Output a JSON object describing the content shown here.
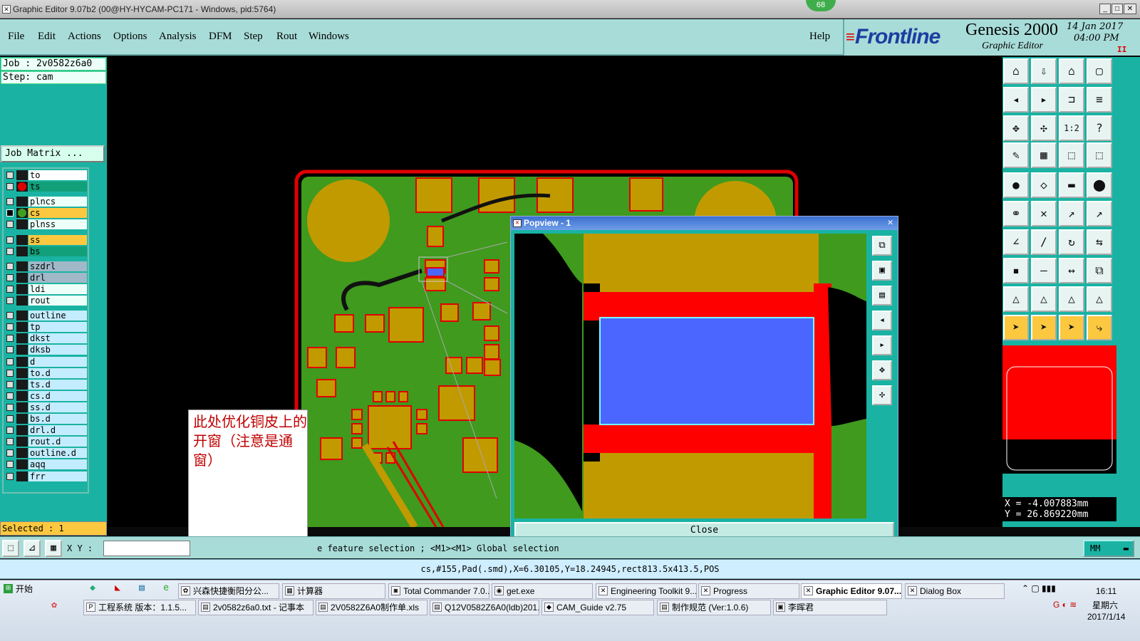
{
  "window": {
    "title": "Graphic Editor 9.07b2 (00@HY-HYCAM-PC171 - Windows, pid:5764)",
    "badge": "68"
  },
  "menu": {
    "items": [
      "File",
      "Edit",
      "Actions",
      "Options",
      "Analysis",
      "DFM",
      "Step",
      "Rout",
      "Windows"
    ],
    "help": "Help"
  },
  "brand": {
    "logo": "Frontline",
    "product": "Genesis 2000",
    "sub": "Graphic Editor",
    "date": "14 Jan 2017",
    "time": "04:00 PM",
    "indicator": "II"
  },
  "job": {
    "job_label": "Job : 2v0582z6a0",
    "step_label": "Step: cam",
    "matrix_btn": "Job Matrix ...",
    "selected": "Selected : 1"
  },
  "layers": [
    {
      "name": "to",
      "color": "#ffffff",
      "checked": false,
      "dot": ""
    },
    {
      "name": "ts",
      "color": "#12a07a",
      "checked": false,
      "dot": "#e00000"
    },
    {
      "name": "plncs",
      "color": "#ecfff9",
      "checked": false,
      "dot": ""
    },
    {
      "name": "cs",
      "color": "#fcc840",
      "checked": true,
      "dot": "#3fa020"
    },
    {
      "name": "plnss",
      "color": "#ecfff9",
      "checked": false,
      "dot": ""
    },
    {
      "name": "ss",
      "color": "#fcc840",
      "checked": false,
      "dot": ""
    },
    {
      "name": "bs",
      "color": "#12a07a",
      "checked": false,
      "dot": ""
    },
    {
      "name": "szdrl",
      "color": "#a0b8c8",
      "checked": false,
      "dot": ""
    },
    {
      "name": "drl",
      "color": "#a0b8c8",
      "checked": false,
      "dot": ""
    },
    {
      "name": "ldi",
      "color": "#ecfff9",
      "checked": false,
      "dot": ""
    },
    {
      "name": "rout",
      "color": "#ecfff9",
      "checked": false,
      "dot": ""
    },
    {
      "name": "outline",
      "color": "#c4ecff",
      "checked": false,
      "dot": ""
    },
    {
      "name": "tp",
      "color": "#c4ecff",
      "checked": false,
      "dot": ""
    },
    {
      "name": "dkst",
      "color": "#c4ecff",
      "checked": false,
      "dot": ""
    },
    {
      "name": "dksb",
      "color": "#c4ecff",
      "checked": false,
      "dot": ""
    },
    {
      "name": "d",
      "color": "#c4ecff",
      "checked": false,
      "dot": ""
    },
    {
      "name": "to.d",
      "color": "#c4ecff",
      "checked": false,
      "dot": ""
    },
    {
      "name": "ts.d",
      "color": "#c4ecff",
      "checked": false,
      "dot": ""
    },
    {
      "name": "cs.d",
      "color": "#c4ecff",
      "checked": false,
      "dot": ""
    },
    {
      "name": "ss.d",
      "color": "#c4ecff",
      "checked": false,
      "dot": ""
    },
    {
      "name": "bs.d",
      "color": "#c4ecff",
      "checked": false,
      "dot": ""
    },
    {
      "name": "drl.d",
      "color": "#c4ecff",
      "checked": false,
      "dot": ""
    },
    {
      "name": "rout.d",
      "color": "#c4ecff",
      "checked": false,
      "dot": ""
    },
    {
      "name": "outline.d",
      "color": "#c4ecff",
      "checked": false,
      "dot": ""
    },
    {
      "name": "aqq",
      "color": "#c4ecff",
      "checked": false,
      "dot": ""
    },
    {
      "name": "frr",
      "color": "#c4ecff",
      "checked": false,
      "dot": ""
    }
  ],
  "toolbar_icons": [
    "home-icon",
    "zoom-home-icon",
    "house-icon",
    "window-icon",
    "pan-left-icon",
    "pan-right-icon",
    "zoom-page-icon",
    "zoom-out-icon",
    "zoom-fit-icon",
    "zoom-center-icon",
    "scale-icon",
    "help-icon",
    "measure-icon",
    "grid-icon",
    "layers-red-icon",
    "layers-black-icon",
    "snap-center-icon",
    "snap-edge-icon",
    "ruler-icon",
    "dot-icon",
    "net-icon",
    "cross-icon",
    "line-node-icon",
    "node-icon",
    "angle-icon",
    "slash-icon",
    "rotate-icon",
    "mirror-icon",
    "pad-icon",
    "minus-icon",
    "width-icon",
    "copy-icon",
    "tri-icon",
    "tri2-icon",
    "tri3-icon",
    "tri4-icon",
    "select-icon",
    "select2-icon",
    "select3-icon",
    "route-icon"
  ],
  "toolbar_glyphs": [
    "⌂",
    "⇩",
    "⌂",
    "▢",
    "◂",
    "▸",
    "⊐",
    "≡",
    "✥",
    "✣",
    "1:2",
    "?",
    "✎",
    "▦",
    "⬚",
    "⬚",
    "●",
    "◇",
    "▬",
    "⬤",
    "⚭",
    "✕",
    "↗",
    "↗",
    "∠",
    "∕",
    "↻",
    "⇆",
    "▪",
    "—",
    "↔",
    "⧉",
    "△",
    "△",
    "△",
    "△",
    "➤",
    "➤",
    "➤",
    "⤷"
  ],
  "coords": {
    "x": "X = -4.007883mm",
    "y": "Y = 26.869220mm"
  },
  "popview": {
    "title": "Popview - 1",
    "close": "Close",
    "tools": [
      "zoom-in-icon",
      "zoom-out-icon",
      "zoom-back-icon",
      "pan-left-icon",
      "pan-right-icon",
      "fit-icon",
      "center-icon"
    ]
  },
  "note": {
    "text": "此处优化铜皮上的开窗（注意是通窗）"
  },
  "cmd": {
    "xy_label": "X Y :",
    "xy_value": "",
    "message": "e feature selection ; <M1><M1> Global selection",
    "unit": "MM"
  },
  "status": {
    "text": "cs,#155,Pad(.smd),X=6.30105,Y=18.24945,rect813.5x413.5,POS"
  },
  "taskbar": {
    "start": "开始",
    "row1": [
      {
        "label": "兴森快捷衡阳分公...",
        "icon": "✿"
      },
      {
        "label": "计算器",
        "icon": "▦"
      },
      {
        "label": "Total Commander 7.0...",
        "icon": "◙"
      },
      {
        "label": "get.exe",
        "icon": "◉"
      },
      {
        "label": "Engineering Toolkit 9....",
        "icon": "✕"
      },
      {
        "label": "Progress",
        "icon": "✕"
      },
      {
        "label": "Graphic Editor 9.07...",
        "icon": "✕"
      },
      {
        "label": "Dialog Box",
        "icon": "✕"
      }
    ],
    "row2": [
      {
        "label": "工程系统  版本：1.1.5...",
        "icon": "P"
      },
      {
        "label": "2v0582z6a0.txt - 记事本",
        "icon": "▤"
      },
      {
        "label": "2V0582Z6A0制作单.xls",
        "icon": "▤"
      },
      {
        "label": "Q12V0582Z6A0(ldb)201...",
        "icon": "▤"
      },
      {
        "label": "CAM_Guide v2.75",
        "icon": "◆"
      },
      {
        "label": "制作规范 (Ver:1.0.6)",
        "icon": "▤"
      },
      {
        "label": "李晖君",
        "icon": "▣"
      }
    ],
    "clock": "16:11",
    "weekday": "星期六",
    "date": "2017/1/14"
  }
}
